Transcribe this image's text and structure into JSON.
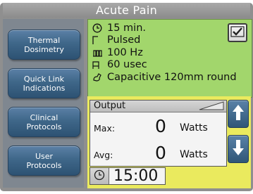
{
  "header": {
    "title": "Acute Pain"
  },
  "sidebar": {
    "items": [
      {
        "label": "Thermal\nDosimetry"
      },
      {
        "label": "Quick Link\nIndications"
      },
      {
        "label": "Clinical\nProtocols"
      },
      {
        "label": "User\nProtocols"
      }
    ]
  },
  "parameters": {
    "duration": "15 min.",
    "mode": "Pulsed",
    "frequency": "100 Hz",
    "pulse_width": "60 usec",
    "applicator": "Capacitive 120mm round"
  },
  "output": {
    "header": "Output",
    "max_label": "Max:",
    "max_value": "0",
    "max_unit": "Watts",
    "avg_label": "Avg:",
    "avg_value": "0",
    "avg_unit": "Watts"
  },
  "timer": {
    "value": "15:00"
  },
  "icons": {
    "confirm": "checkmark-icon",
    "increase": "arrow-up-icon",
    "decrease": "arrow-down-icon",
    "timer": "clock-icon",
    "duration": "clock-icon",
    "mode": "pulse-wave-icon",
    "frequency": "frequency-wave-icon",
    "pulse_width": "pulse-width-icon",
    "applicator": "applicator-icon",
    "ramp": "ramp-icon"
  },
  "colors": {
    "title_bar": "#9a9a9a",
    "sidebar_button": "#3f6789",
    "parameters_panel": "#a2d66c",
    "output_panel": "#eaea5e"
  }
}
